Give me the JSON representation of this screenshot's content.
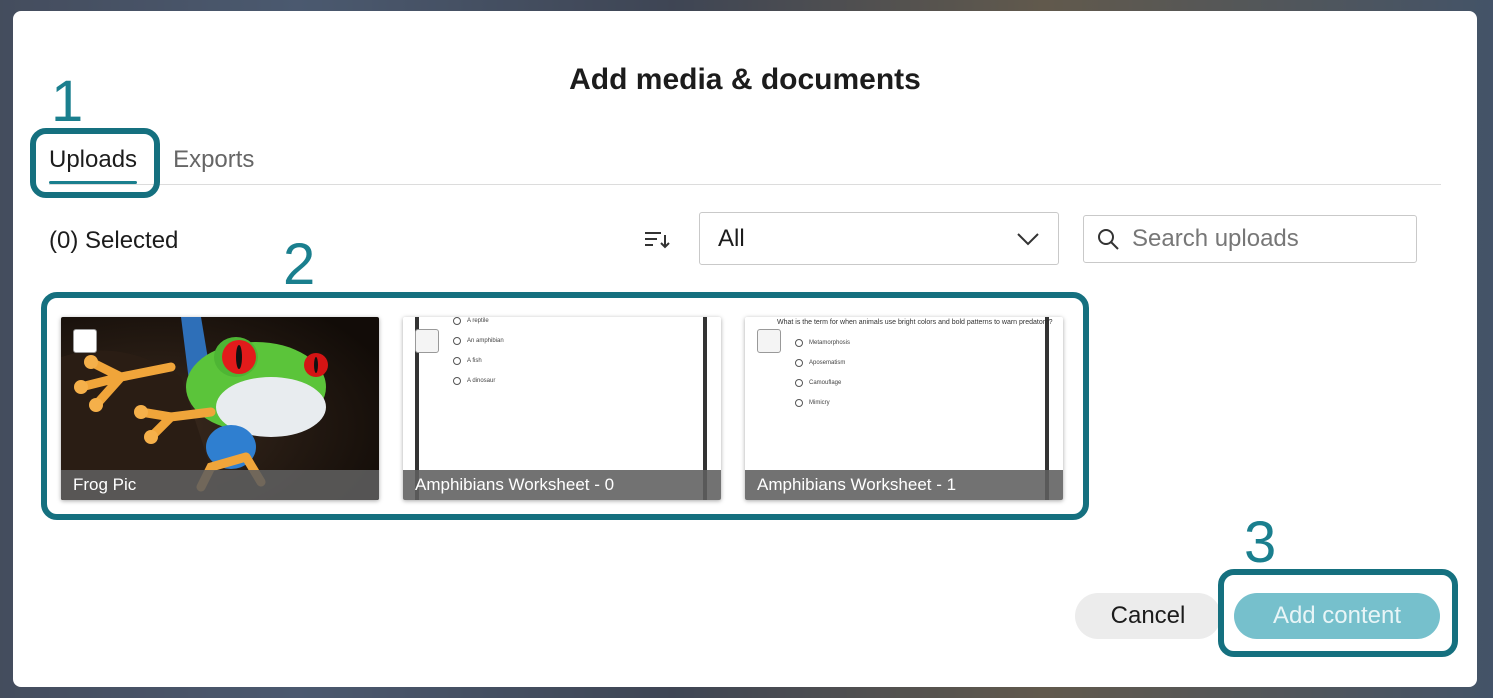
{
  "dialog": {
    "title": "Add media & documents"
  },
  "annotations": {
    "step1": "1",
    "step2": "2",
    "step3": "3"
  },
  "tabs": [
    {
      "label": "Uploads",
      "active": true
    },
    {
      "label": "Exports",
      "active": false
    }
  ],
  "toolbar": {
    "selected_count": "(0) Selected",
    "filter_value": "All",
    "search_placeholder": "Search uploads"
  },
  "items": [
    {
      "caption": "Frog Pic",
      "type": "image"
    },
    {
      "caption": "Amphibians Worksheet - 0",
      "type": "worksheet",
      "options": [
        "A reptile",
        "An amphibian",
        "A fish",
        "A dinosaur"
      ]
    },
    {
      "caption": "Amphibians Worksheet - 1",
      "type": "worksheet",
      "question": "What is the term for when animals use bright colors and bold patterns to warn predators?",
      "options": [
        "Metamorphosis",
        "Aposematism",
        "Camouflage",
        "Mimicry"
      ]
    }
  ],
  "footer": {
    "cancel_label": "Cancel",
    "add_label": "Add content"
  },
  "colors": {
    "accent": "#1a7f8e",
    "highlight": "#15707f",
    "add_button_disabled": "#76c0cc"
  }
}
